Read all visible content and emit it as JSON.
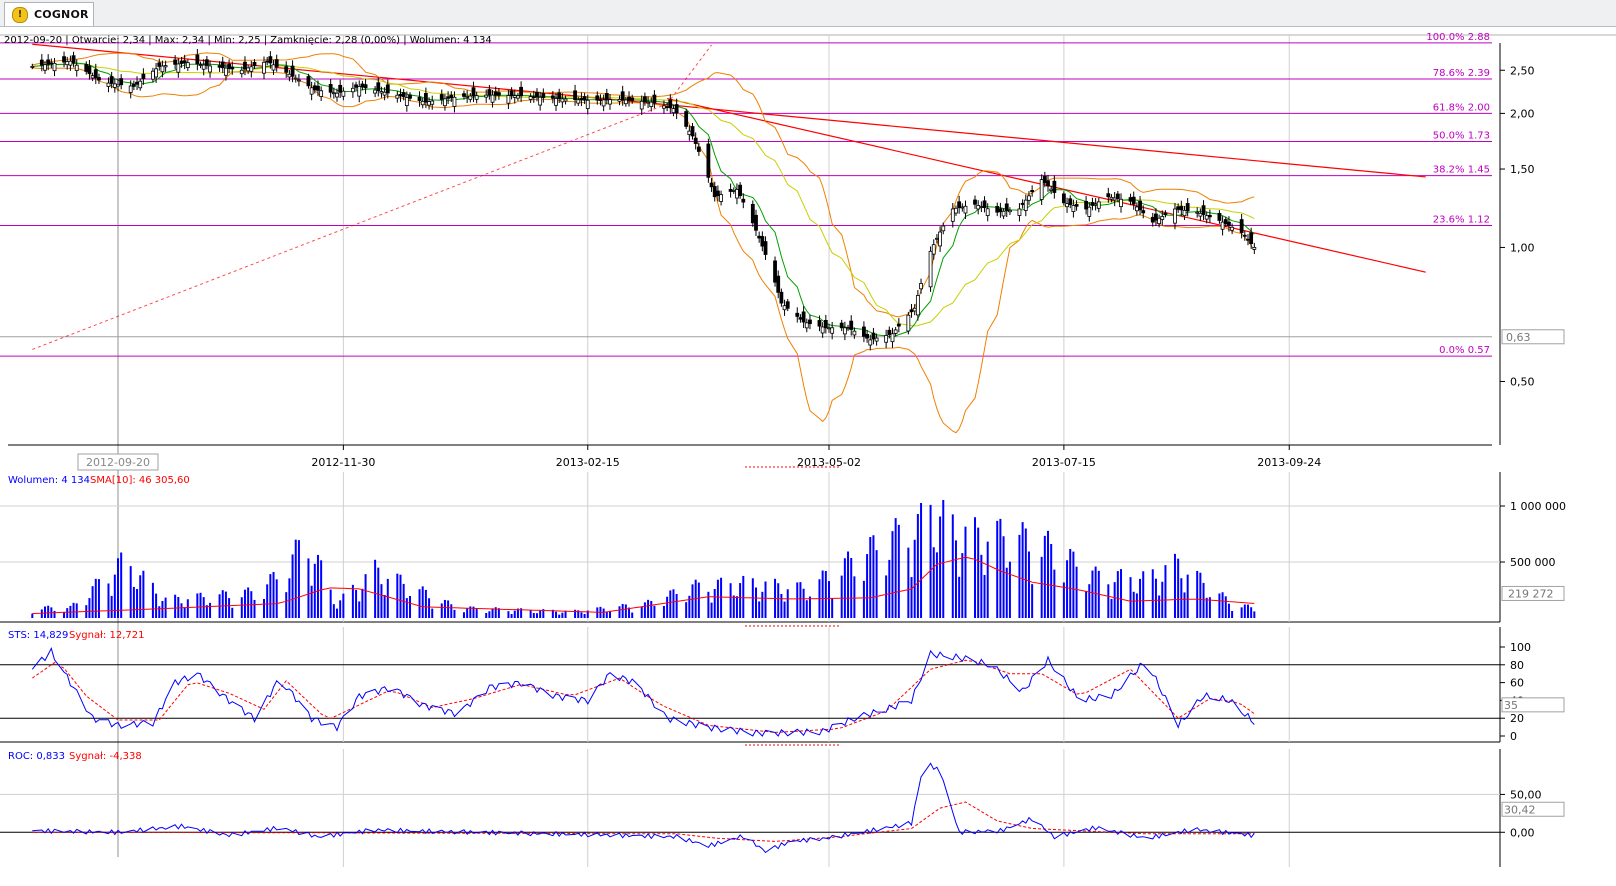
{
  "window": {
    "tab_title": "COGNOR",
    "tab_icon": "warning-icon"
  },
  "colors": {
    "candle": "#000000",
    "fib": "#c000c0",
    "trend": "#ff0000",
    "bollinger": "#f08000",
    "ma_green": "#00a000",
    "ma_yellow": "#c8d000",
    "volume": "#0000ff",
    "sma": "#ff0000",
    "sts": "#0000ff",
    "signal": "#ff0000",
    "grid": "#d0d0d0"
  },
  "chart_data": [
    {
      "type": "candlestick",
      "info": {
        "date": "2012-09-20",
        "open": "2,34",
        "max": "2,34",
        "min": "2,25",
        "close": "2,28 (0,00%)",
        "volume": "4 134"
      },
      "info_text": "2012-09-20 | Otwarcie: 2,34 | Max: 2,34 | Min: 2,25 | Zamknięcie: 2,28 (0,00%)  | Wolumen: 4 134",
      "y_scale": "log",
      "ylim": [
        0.36,
        3.0
      ],
      "y_ticks": [
        {
          "v": 2.5,
          "label": "2,50"
        },
        {
          "v": 2.0,
          "label": "2,00"
        },
        {
          "v": 1.5,
          "label": "1,50"
        },
        {
          "v": 1.0,
          "label": "1,00"
        },
        {
          "v": 0.5,
          "label": "0,50"
        }
      ],
      "x_ticks": [
        "2012-11-30",
        "2013-02-15",
        "2013-05-02",
        "2013-07-15",
        "2013-09-24"
      ],
      "cursor_date": "2012-09-20",
      "last_value_label": "0,63",
      "last_value": 0.63,
      "fibonacci": [
        {
          "label": "100.0% 2.88",
          "v": 2.88
        },
        {
          "label": "78.6% 2.39",
          "v": 2.39
        },
        {
          "label": "61.8% 2.00",
          "v": 2.0
        },
        {
          "label": "50.0% 1.73",
          "v": 1.73
        },
        {
          "label": "38.2% 1.45",
          "v": 1.45
        },
        {
          "label": "23.6% 1.12",
          "v": 1.12
        },
        {
          "label": "0.0% 0.57",
          "v": 0.57
        }
      ],
      "trendlines": [
        {
          "x": [
            "2012-08-24",
            "2013-11-06"
          ],
          "y": [
            2.86,
            1.44
          ],
          "style": "solid"
        },
        {
          "x": [
            "2013-03-12",
            "2013-11-06"
          ],
          "y": [
            2.16,
            0.88
          ],
          "style": "solid"
        },
        {
          "x": [
            "2012-08-24",
            "2013-03-12"
          ],
          "y": [
            0.59,
            2.1
          ],
          "style": "dashed"
        },
        {
          "x": [
            "2013-03-12",
            "2013-03-26"
          ],
          "y": [
            2.1,
            2.85
          ],
          "style": "dashed"
        }
      ],
      "close_path": [
        [
          "2012-08-24",
          2.55
        ],
        [
          "2012-09-05",
          2.62
        ],
        [
          "2012-09-15",
          2.35
        ],
        [
          "2012-09-25",
          2.3
        ],
        [
          "2012-10-03",
          2.55
        ],
        [
          "2012-10-12",
          2.6
        ],
        [
          "2012-10-20",
          2.55
        ],
        [
          "2012-10-29",
          2.5
        ],
        [
          "2012-11-06",
          2.62
        ],
        [
          "2012-11-15",
          2.4
        ],
        [
          "2012-11-21",
          2.26
        ],
        [
          "2012-11-28",
          2.22
        ],
        [
          "2012-12-05",
          2.3
        ],
        [
          "2012-12-12",
          2.24
        ],
        [
          "2012-12-19",
          2.18
        ],
        [
          "2012-12-26",
          2.12
        ],
        [
          "2013-01-05",
          2.18
        ],
        [
          "2013-01-15",
          2.2
        ],
        [
          "2013-01-25",
          2.19
        ],
        [
          "2013-02-05",
          2.16
        ],
        [
          "2013-02-15",
          2.14
        ],
        [
          "2013-02-25",
          2.15
        ],
        [
          "2013-03-07",
          2.12
        ],
        [
          "2013-03-14",
          2.05
        ],
        [
          "2013-03-20",
          1.78
        ],
        [
          "2013-03-27",
          1.3
        ],
        [
          "2013-04-03",
          1.35
        ],
        [
          "2013-04-10",
          1.05
        ],
        [
          "2013-04-17",
          0.75
        ],
        [
          "2013-04-24",
          0.68
        ],
        [
          "2013-05-01",
          0.66
        ],
        [
          "2013-05-08",
          0.66
        ],
        [
          "2013-05-15",
          0.62
        ],
        [
          "2013-05-22",
          0.64
        ],
        [
          "2013-05-29",
          0.73
        ],
        [
          "2013-06-03",
          0.98
        ],
        [
          "2013-06-10",
          1.22
        ],
        [
          "2013-06-17",
          1.25
        ],
        [
          "2013-06-24",
          1.2
        ],
        [
          "2013-07-01",
          1.22
        ],
        [
          "2013-07-08",
          1.42
        ],
        [
          "2013-07-15",
          1.26
        ],
        [
          "2013-07-22",
          1.22
        ],
        [
          "2013-07-29",
          1.3
        ],
        [
          "2013-08-05",
          1.27
        ],
        [
          "2013-08-12",
          1.14
        ],
        [
          "2013-08-19",
          1.22
        ],
        [
          "2013-08-26",
          1.2
        ],
        [
          "2013-09-02",
          1.15
        ],
        [
          "2013-09-09",
          1.08
        ],
        [
          "2013-09-13",
          1.0
        ]
      ]
    },
    {
      "type": "bar",
      "title_volume": "Wolumen: 4 134",
      "title_sma": "SMA[10]: 46 305,60",
      "ylim": [
        0,
        1250000
      ],
      "y_ticks": [
        {
          "v": 1000000,
          "label": "1 000 000"
        },
        {
          "v": 500000,
          "label": "500 000"
        }
      ],
      "last_value_label": "219 272",
      "last_value": 219272,
      "volume_path": [
        [
          "2012-09-05",
          110000
        ],
        [
          "2012-09-22",
          620000
        ],
        [
          "2012-10-05",
          200000
        ],
        [
          "2012-10-20",
          240000
        ],
        [
          "2012-11-02",
          280000
        ],
        [
          "2012-11-12",
          520000
        ],
        [
          "2012-11-18",
          880000
        ],
        [
          "2012-11-28",
          160000
        ],
        [
          "2012-12-10",
          520000
        ],
        [
          "2013-01-05",
          110000
        ],
        [
          "2013-02-10",
          70000
        ],
        [
          "2013-03-05",
          150000
        ],
        [
          "2013-03-20",
          340000
        ],
        [
          "2013-04-05",
          380000
        ],
        [
          "2013-04-25",
          320000
        ],
        [
          "2013-05-12",
          680000
        ],
        [
          "2013-05-22",
          880000
        ],
        [
          "2013-05-30",
          980000
        ],
        [
          "2013-06-03",
          1200000
        ],
        [
          "2013-06-12",
          900000
        ],
        [
          "2013-06-28",
          900000
        ],
        [
          "2013-07-10",
          780000
        ],
        [
          "2013-07-25",
          460000
        ],
        [
          "2013-08-10",
          420000
        ],
        [
          "2013-08-20",
          590000
        ],
        [
          "2013-09-05",
          180000
        ],
        [
          "2013-09-13",
          100000
        ]
      ],
      "sma_path": [
        [
          "2012-08-24",
          40000
        ],
        [
          "2012-10-01",
          80000
        ],
        [
          "2012-11-10",
          130000
        ],
        [
          "2012-11-25",
          270000
        ],
        [
          "2012-12-05",
          260000
        ],
        [
          "2012-12-25",
          100000
        ],
        [
          "2013-02-20",
          50000
        ],
        [
          "2013-03-25",
          190000
        ],
        [
          "2013-04-20",
          170000
        ],
        [
          "2013-05-15",
          180000
        ],
        [
          "2013-05-28",
          260000
        ],
        [
          "2013-06-05",
          480000
        ],
        [
          "2013-06-15",
          550000
        ],
        [
          "2013-06-25",
          420000
        ],
        [
          "2013-07-05",
          320000
        ],
        [
          "2013-07-20",
          250000
        ],
        [
          "2013-08-05",
          150000
        ],
        [
          "2013-08-25",
          170000
        ],
        [
          "2013-09-13",
          130000
        ]
      ]
    },
    {
      "type": "line",
      "title_sts": "STS: 14,829",
      "title_signal": "Sygnał: 12,721",
      "ylim": [
        0,
        100
      ],
      "y_ticks": [
        {
          "v": 100,
          "label": "100"
        },
        {
          "v": 80,
          "label": "80"
        },
        {
          "v": 60,
          "label": "60"
        },
        {
          "v": 40,
          "label": "40"
        },
        {
          "v": 20,
          "label": "20"
        },
        {
          "v": 0,
          "label": "0"
        }
      ],
      "levels": [
        80,
        20
      ],
      "last_value_label": "35",
      "last_value": 35,
      "sts_path": [
        [
          "2012-08-24",
          75
        ],
        [
          "2012-08-30",
          95
        ],
        [
          "2012-09-05",
          60
        ],
        [
          "2012-09-12",
          20
        ],
        [
          "2012-09-20",
          12
        ],
        [
          "2012-10-01",
          15
        ],
        [
          "2012-10-08",
          60
        ],
        [
          "2012-10-15",
          70
        ],
        [
          "2012-10-25",
          40
        ],
        [
          "2012-11-02",
          20
        ],
        [
          "2012-11-10",
          65
        ],
        [
          "2012-11-20",
          20
        ],
        [
          "2012-11-28",
          10
        ],
        [
          "2012-12-05",
          45
        ],
        [
          "2012-12-15",
          55
        ],
        [
          "2012-12-25",
          35
        ],
        [
          "2013-01-05",
          25
        ],
        [
          "2013-01-15",
          55
        ],
        [
          "2013-01-25",
          60
        ],
        [
          "2013-02-05",
          45
        ],
        [
          "2013-02-15",
          40
        ],
        [
          "2013-02-22",
          70
        ],
        [
          "2013-03-02",
          60
        ],
        [
          "2013-03-12",
          20
        ],
        [
          "2013-03-25",
          10
        ],
        [
          "2013-04-10",
          3
        ],
        [
          "2013-04-30",
          5
        ],
        [
          "2013-05-10",
          20
        ],
        [
          "2013-05-20",
          30
        ],
        [
          "2013-05-28",
          40
        ],
        [
          "2013-06-03",
          92
        ],
        [
          "2013-06-12",
          88
        ],
        [
          "2013-06-22",
          80
        ],
        [
          "2013-07-02",
          50
        ],
        [
          "2013-07-10",
          85
        ],
        [
          "2013-07-20",
          40
        ],
        [
          "2013-07-30",
          45
        ],
        [
          "2013-08-10",
          85
        ],
        [
          "2013-08-20",
          12
        ],
        [
          "2013-08-28",
          45
        ],
        [
          "2013-09-05",
          40
        ],
        [
          "2013-09-13",
          15
        ]
      ],
      "signal_path": [
        [
          "2012-08-24",
          65
        ],
        [
          "2012-09-01",
          85
        ],
        [
          "2012-09-10",
          45
        ],
        [
          "2012-09-20",
          18
        ],
        [
          "2012-10-03",
          18
        ],
        [
          "2012-10-13",
          62
        ],
        [
          "2012-10-25",
          48
        ],
        [
          "2012-11-05",
          30
        ],
        [
          "2012-11-12",
          62
        ],
        [
          "2012-11-25",
          18
        ],
        [
          "2012-12-05",
          35
        ],
        [
          "2012-12-15",
          52
        ],
        [
          "2012-12-28",
          32
        ],
        [
          "2013-01-10",
          42
        ],
        [
          "2013-01-25",
          58
        ],
        [
          "2013-02-10",
          45
        ],
        [
          "2013-02-25",
          65
        ],
        [
          "2013-03-10",
          35
        ],
        [
          "2013-03-25",
          12
        ],
        [
          "2013-04-15",
          4
        ],
        [
          "2013-05-05",
          8
        ],
        [
          "2013-05-20",
          28
        ],
        [
          "2013-06-03",
          75
        ],
        [
          "2013-06-15",
          86
        ],
        [
          "2013-06-28",
          70
        ],
        [
          "2013-07-08",
          70
        ],
        [
          "2013-07-20",
          45
        ],
        [
          "2013-08-05",
          75
        ],
        [
          "2013-08-20",
          20
        ],
        [
          "2013-08-30",
          42
        ],
        [
          "2013-09-08",
          38
        ],
        [
          "2013-09-13",
          25
        ]
      ]
    },
    {
      "type": "line",
      "title_roc": "ROC: 0,833",
      "title_signal": "Sygnał: -4,338",
      "ylim": [
        -30,
        110
      ],
      "y_ticks": [
        {
          "v": 50,
          "label": "50,00"
        },
        {
          "v": 0,
          "label": "0,00"
        }
      ],
      "last_value_label": "30,42",
      "last_value": 30.42,
      "roc_path": [
        [
          "2012-08-24",
          2
        ],
        [
          "2012-09-20",
          0
        ],
        [
          "2012-10-10",
          8
        ],
        [
          "2012-10-25",
          -4
        ],
        [
          "2012-11-10",
          6
        ],
        [
          "2012-11-22",
          -6
        ],
        [
          "2012-12-10",
          3
        ],
        [
          "2013-01-10",
          0
        ],
        [
          "2013-02-15",
          -3
        ],
        [
          "2013-03-15",
          -6
        ],
        [
          "2013-03-25",
          -18
        ],
        [
          "2013-04-05",
          -5
        ],
        [
          "2013-04-12",
          -25
        ],
        [
          "2013-04-20",
          -12
        ],
        [
          "2013-05-01",
          -8
        ],
        [
          "2013-05-15",
          2
        ],
        [
          "2013-05-28",
          12
        ],
        [
          "2013-06-01",
          95
        ],
        [
          "2013-06-06",
          80
        ],
        [
          "2013-06-12",
          0
        ],
        [
          "2013-06-25",
          2
        ],
        [
          "2013-07-05",
          18
        ],
        [
          "2013-07-12",
          -6
        ],
        [
          "2013-07-25",
          6
        ],
        [
          "2013-08-10",
          -8
        ],
        [
          "2013-08-25",
          4
        ],
        [
          "2013-09-13",
          -4
        ]
      ],
      "signal_path": [
        [
          "2012-08-24",
          0
        ],
        [
          "2012-09-20",
          0
        ],
        [
          "2013-03-15",
          -2
        ],
        [
          "2013-03-28",
          -8
        ],
        [
          "2013-04-15",
          -12
        ],
        [
          "2013-05-05",
          -6
        ],
        [
          "2013-05-28",
          5
        ],
        [
          "2013-06-06",
          32
        ],
        [
          "2013-06-14",
          40
        ],
        [
          "2013-06-24",
          15
        ],
        [
          "2013-07-05",
          5
        ],
        [
          "2013-08-10",
          -2
        ],
        [
          "2013-09-13",
          -2
        ]
      ]
    }
  ]
}
